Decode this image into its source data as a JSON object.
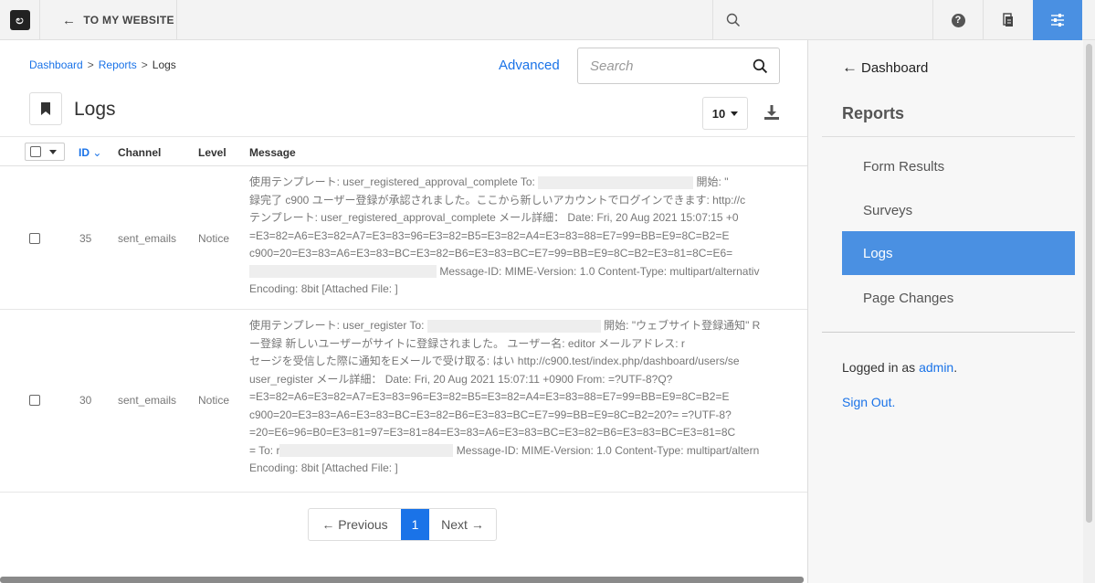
{
  "toolbar": {
    "logo_glyph": "ಲ",
    "back_label": "TO MY WEBSITE",
    "help_glyph": "?"
  },
  "breadcrumb": [
    "Dashboard",
    "Reports",
    "Logs"
  ],
  "search": {
    "advanced_label": "Advanced",
    "placeholder": "Search"
  },
  "page": {
    "title": "Logs",
    "per_page": "10"
  },
  "table": {
    "headers": {
      "id": "ID",
      "channel": "Channel",
      "level": "Level",
      "message": "Message"
    },
    "rows": [
      {
        "id": "35",
        "channel": "sent_emails",
        "level": "Notice",
        "message_lines": [
          [
            "使用テンプレート: user_registered_approval_complete To: ",
            "",
            " 開始: \""
          ],
          [
            "録完了 c900 ユーザー登録が承認されました。ここから新しいアカウントでログインできます: http://c"
          ],
          [
            "テンプレート: user_registered_approval_complete メール詳細： Date: Fri, 20 Aug 2021 15:07:15 +0"
          ],
          [
            "=E3=82=A6=E3=82=A7=E3=83=96=E3=82=B5=E3=82=A4=E3=83=88=E7=99=BB=E9=8C=B2=E"
          ],
          [
            "c900=20=E3=83=A6=E3=83=BC=E3=82=B6=E3=83=BC=E7=99=BB=E9=8C=B2=E3=81=8C=E6="
          ],
          [
            "",
            "",
            " Message-ID: MIME-Version: 1.0 Content-Type: multipart/alternativ"
          ],
          [
            "Encoding: 8bit [Attached File: ]"
          ]
        ]
      },
      {
        "id": "30",
        "channel": "sent_emails",
        "level": "Notice",
        "message_lines": [
          [
            "使用テンプレート: user_register To: ",
            "",
            " 開始: \"ウェブサイト登録通知\" R"
          ],
          [
            "ー登録 新しいユーザーがサイトに登録されました。 ユーザー名: editor メールアドレス: r"
          ],
          [
            "セージを受信した際に通知をEメールで受け取る: はい http://c900.test/index.php/dashboard/users/se"
          ],
          [
            "user_register メール詳細： Date: Fri, 20 Aug 2021 15:07:11 +0900 From: =?UTF-8?Q?"
          ],
          [
            "=E3=82=A6=E3=82=A7=E3=83=96=E3=82=B5=E3=82=A4=E3=83=88=E7=99=BB=E9=8C=B2=E"
          ],
          [
            "c900=20=E3=83=A6=E3=83=BC=E3=82=B6=E3=83=BC=E7=99=BB=E9=8C=B2=20?= =?UTF-8?"
          ],
          [
            "=20=E6=96=B0=E3=81=97=E3=81=84=E3=83=A6=E3=83=BC=E3=82=B6=E3=83=BC=E3=81=8C"
          ],
          [
            "= To: r",
            "",
            " Message-ID: MIME-Version: 1.0 Content-Type: multipart/altern"
          ],
          [
            "Encoding: 8bit [Attached File: ]"
          ]
        ]
      }
    ]
  },
  "pagination": {
    "prev": "← Previous",
    "current": "1",
    "next": "Next →"
  },
  "panel": {
    "back_label": "Dashboard",
    "section_title": "Reports",
    "items": [
      {
        "label": "Form Results",
        "active": false
      },
      {
        "label": "Surveys",
        "active": false
      },
      {
        "label": "Logs",
        "active": true
      },
      {
        "label": "Page Changes",
        "active": false
      }
    ],
    "logged_in_prefix": "Logged in as ",
    "logged_in_user": "admin",
    "logged_in_suffix": ".",
    "sign_out_label": "Sign Out."
  },
  "colors": {
    "accent": "#4a90e2",
    "link": "#1a73e8"
  }
}
